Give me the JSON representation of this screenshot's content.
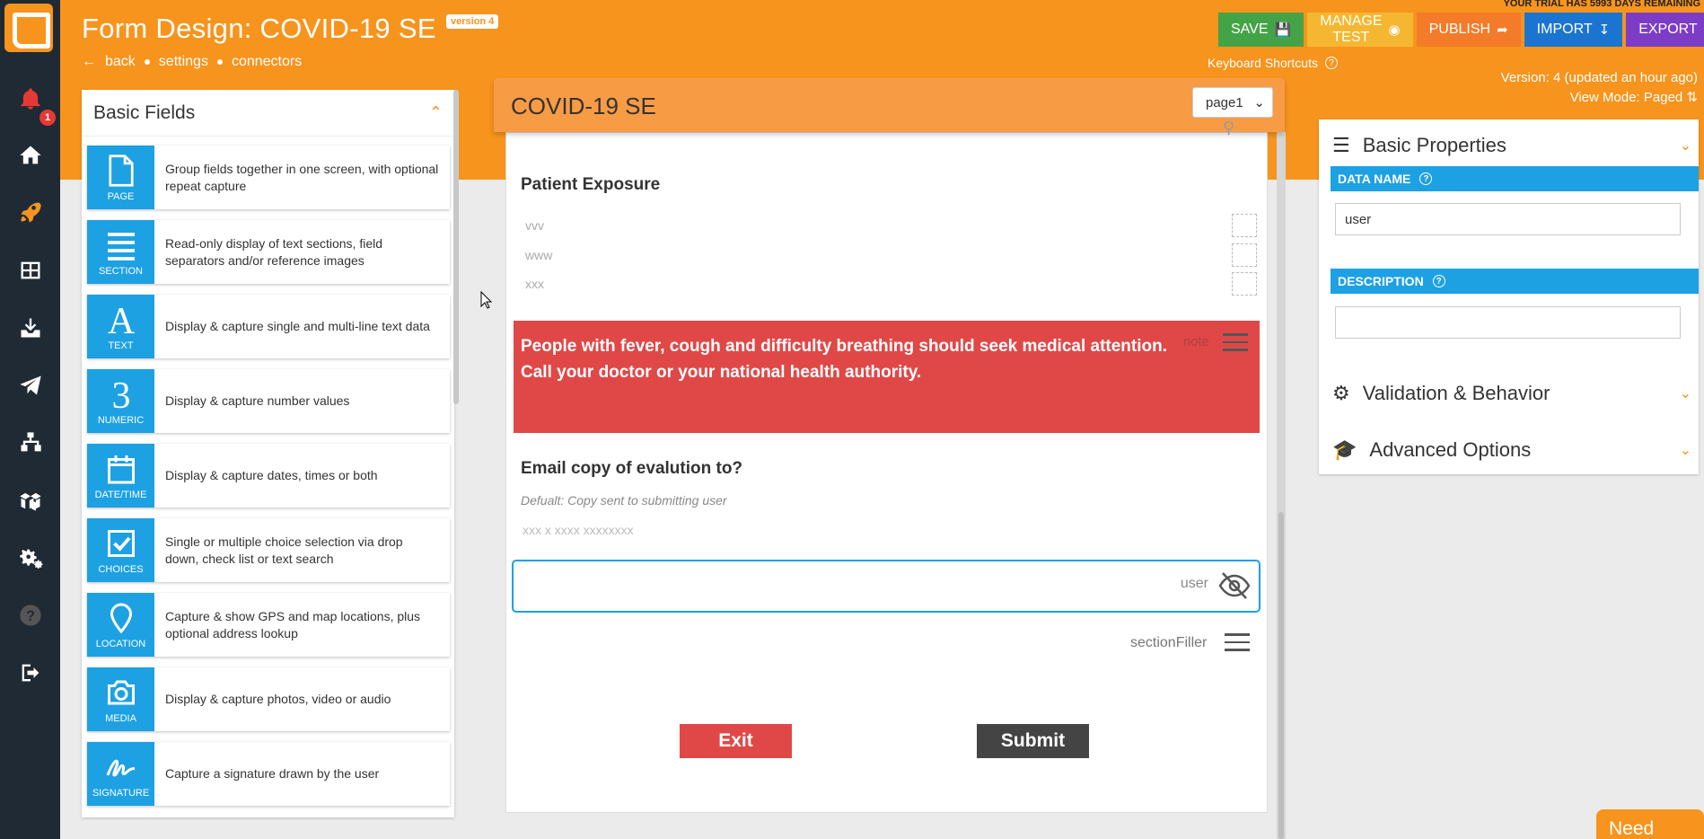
{
  "app": {
    "title": "Form Design: COVID-19 SE",
    "version_badge": "version 4",
    "trial_notice": "YOUR TRIAL HAS 5993 DAYS REMAINING",
    "notification_count": "1"
  },
  "subnav": {
    "back": "back",
    "settings": "settings",
    "connectors": "connectors"
  },
  "toolbar": {
    "save": "SAVE",
    "manage_test": "MANAGE TEST",
    "publish": "PUBLISH",
    "import": "IMPORT",
    "export": "EXPORT",
    "keyboard_shortcuts": "Keyboard Shortcuts",
    "version_info": "Version: 4 (updated an hour ago)",
    "view_mode": "View Mode: Paged"
  },
  "colors": {
    "brand_orange": "#f7941d",
    "field_blue": "#1da1e3",
    "save_green": "#45a347",
    "manage_yellow": "#f5b731",
    "publish_orange": "#f47b2a",
    "import_blue": "#1b75d0",
    "export_purple": "#7d3cc5",
    "note_red": "#e04848"
  },
  "basic_fields": {
    "title": "Basic Fields",
    "items": [
      {
        "label": "PAGE",
        "icon": "page-icon",
        "description": "Group fields together in one screen, with optional repeat capture"
      },
      {
        "label": "SECTION",
        "icon": "section-icon",
        "description": "Read-only display of text sections, field separators and/or reference images"
      },
      {
        "label": "TEXT",
        "icon": "text-icon",
        "description": "Display & capture single and multi-line text data"
      },
      {
        "label": "NUMERIC",
        "icon": "numeric-icon",
        "description": "Display & capture number values"
      },
      {
        "label": "DATE/TIME",
        "icon": "calendar-icon",
        "description": "Display & capture dates, times or both"
      },
      {
        "label": "CHOICES",
        "icon": "checkbox-icon",
        "description": "Single or multiple choice selection via drop down, check list or text search"
      },
      {
        "label": "LOCATION",
        "icon": "location-pin-icon",
        "description": "Capture & show GPS and map locations, plus optional address lookup"
      },
      {
        "label": "MEDIA",
        "icon": "camera-icon",
        "description": "Display & capture photos, video or audio"
      },
      {
        "label": "SIGNATURE",
        "icon": "signature-icon",
        "description": "Capture a signature drawn by the user"
      }
    ]
  },
  "preview": {
    "form_title": "COVID-19 SE",
    "page_select": "page1",
    "patient_exposure": {
      "title": "Patient Exposure",
      "options": [
        "vvv",
        "www",
        "xxx"
      ]
    },
    "note": {
      "line1": "People with fever, cough and difficulty breathing should seek medical attention.",
      "line2": "Call your doctor or your national health authority.",
      "tag": "note"
    },
    "email": {
      "title": "Email copy of evalution to?",
      "hint": "Defualt: Copy sent to submitting user",
      "placeholder": "xxx x xxxx xxxxxxxx",
      "field_tag": "user"
    },
    "section_filler": "sectionFiller",
    "exit": "Exit",
    "submit": "Submit"
  },
  "properties": {
    "basic_title": "Basic Properties",
    "data_name_label": "DATA NAME",
    "data_name_value": "user",
    "description_label": "DESCRIPTION",
    "description_value": "",
    "validation_title": "Validation & Behavior",
    "advanced_title": "Advanced Options"
  },
  "help": {
    "need_help": "Need Help"
  }
}
